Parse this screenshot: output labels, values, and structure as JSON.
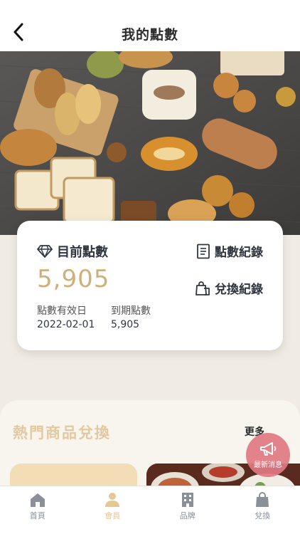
{
  "header": {
    "title": "我的點數",
    "back_icon": "chevron-left-icon"
  },
  "points": {
    "label": "目前點數",
    "value": "5,905",
    "valid_date_label": "點數有效日",
    "valid_date_value": "2022-02-01",
    "expire_label": "到期點數",
    "expire_value": "5,905",
    "history_link": "點數紀錄",
    "redeem_link": "兌換紀錄"
  },
  "hot": {
    "title": "熱門商品兌換",
    "more": "更多"
  },
  "news_button": {
    "label": "最新消息",
    "icon": "megaphone-icon"
  },
  "tabs": [
    {
      "label": "首頁",
      "icon": "home-icon",
      "active": false
    },
    {
      "label": "會員",
      "icon": "person-icon",
      "active": true
    },
    {
      "label": "品牌",
      "icon": "building-icon",
      "active": false
    },
    {
      "label": "兌換",
      "icon": "bag-icon",
      "active": false
    }
  ],
  "colors": {
    "accent": "#cdb07a",
    "tab_active": "#e6c895",
    "tab_inactive": "#8a8f98",
    "news_fab": "#e07882"
  }
}
